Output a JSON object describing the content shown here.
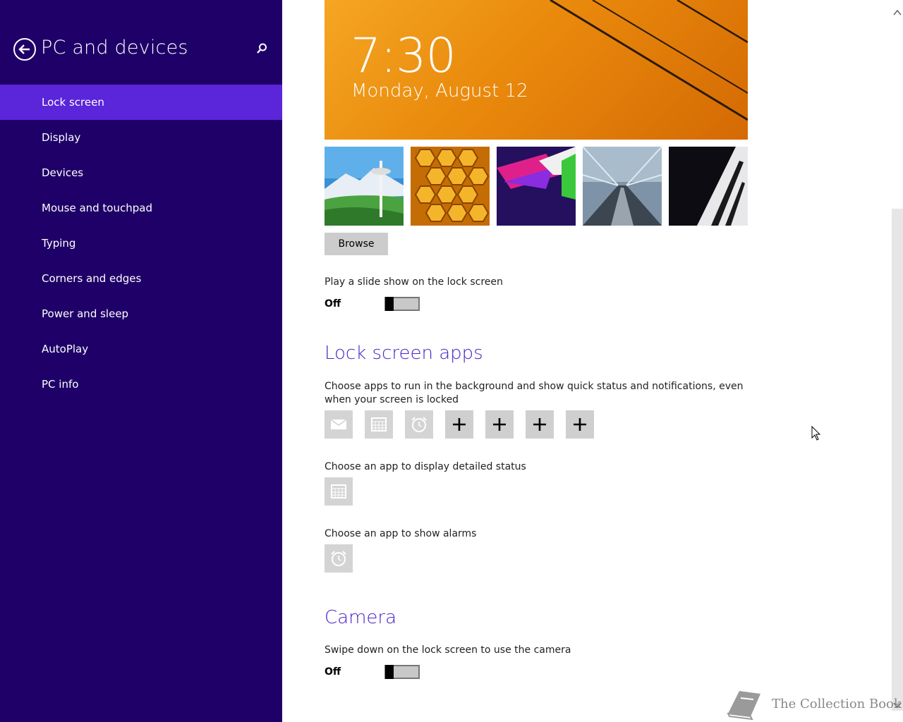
{
  "sidebar": {
    "title": "PC and devices",
    "items": [
      {
        "label": "Lock screen",
        "active": true
      },
      {
        "label": "Display"
      },
      {
        "label": "Devices"
      },
      {
        "label": "Mouse and touchpad"
      },
      {
        "label": "Typing"
      },
      {
        "label": "Corners and edges"
      },
      {
        "label": "Power and sleep"
      },
      {
        "label": "AutoPlay"
      },
      {
        "label": "PC info"
      }
    ]
  },
  "preview": {
    "time": "7:30",
    "date": "Monday, August 12"
  },
  "thumbnails": [
    {
      "name": "space-needle"
    },
    {
      "name": "honeycomb"
    },
    {
      "name": "abstract-shapes"
    },
    {
      "name": "train-tunnel"
    },
    {
      "name": "piano-keys"
    }
  ],
  "browse_label": "Browse",
  "slideshow": {
    "label": "Play a slide show on the lock screen",
    "state": "Off"
  },
  "lock_screen_apps": {
    "heading": "Lock screen apps",
    "description": "Choose apps to run in the background and show quick status and notifications, even when your screen is locked",
    "slots": [
      "mail-icon",
      "calendar-icon",
      "alarm-icon",
      "plus-icon",
      "plus-icon",
      "plus-icon",
      "plus-icon"
    ],
    "detailed_status_label": "Choose an app to display detailed status",
    "alarms_label": "Choose an app to show alarms"
  },
  "camera": {
    "heading": "Camera",
    "label": "Swipe down on the lock screen to use the camera",
    "state": "Off"
  },
  "watermark": "The Collection Book",
  "colors": {
    "sidebar_bg": "#1f0068",
    "active_item": "#5b25d9",
    "heading_accent": "#4a24c8"
  }
}
